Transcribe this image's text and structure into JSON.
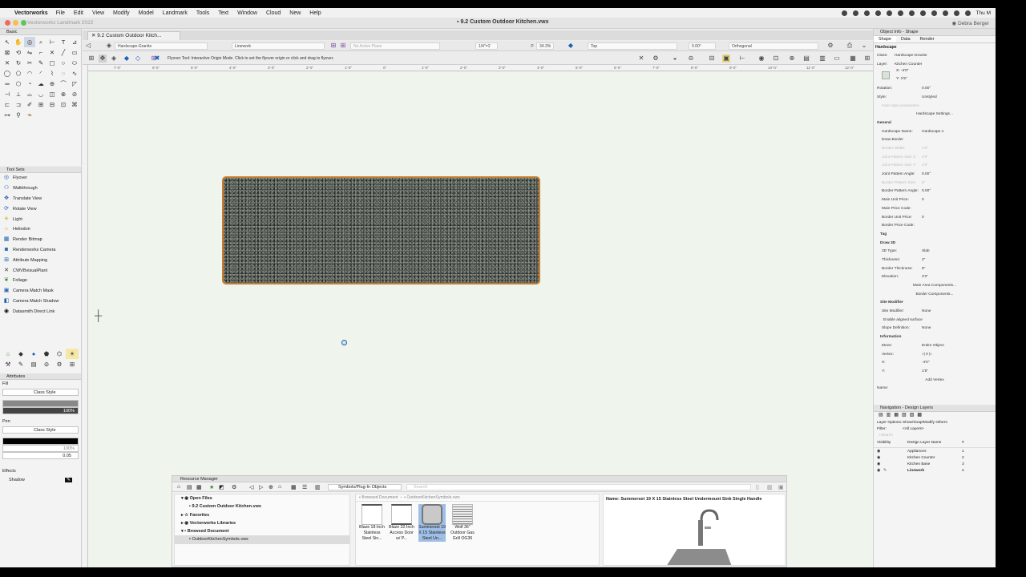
{
  "menubar": {
    "app": "Vectorworks",
    "items": [
      "File",
      "Edit",
      "View",
      "Modify",
      "Model",
      "Landmark",
      "Tools",
      "Text",
      "Window",
      "Cloud",
      "New",
      "Help"
    ],
    "clock": "Thu M"
  },
  "window": {
    "app_title": "Vectorworks Landmark 2022",
    "doc_title": "9.2 Custom Outdoor Kitchen.vwx",
    "user": "Debra Berger",
    "doc_tab": "9.2 Custom Outdoor Kitch..."
  },
  "viewbar": {
    "class_value": "Hardscape-Granite",
    "layer_value": "Linework",
    "active_plane": "No Active Plane",
    "scale": "1/4\"=1'",
    "zoom": "34.3%",
    "view": "Top",
    "rotation": "0.00°",
    "projection": "Orthogonal"
  },
  "modebar": {
    "help_text": "Flyover Tool: Interactive Origin Mode. Click to set the flyover origin or click and drag to flyover."
  },
  "rulers": {
    "top_ticks": [
      "7'-0\"",
      "6'-0\"",
      "5'-0\"",
      "4'-0\"",
      "3'-0\"",
      "2'-0\"",
      "1'-0\"",
      "0\"",
      "1'-0\"",
      "2'-0\"",
      "3'-0\"",
      "4'-0\"",
      "5'-0\"",
      "6'-0\"",
      "7'-0\"",
      "8'-0\"",
      "9'-0\"",
      "10'-0\"",
      "11'-0\"",
      "12'-0\""
    ]
  },
  "basic_palette": {
    "title": "Basic"
  },
  "tool_sets": {
    "title": "Tool Sets",
    "items": [
      "Flyover",
      "Walkthrough",
      "Translate View",
      "Rotate View",
      "Light",
      "Heliodon",
      "Render Bitmap",
      "Renderworks Camera",
      "Attribute Mapping",
      "CWVBvisualPlant",
      "Foliage",
      "Camera Match Mask",
      "Camera Match Shadow",
      "Datasmith Direct Link"
    ]
  },
  "attributes": {
    "title": "Attributes",
    "fill_label": "Fill",
    "fill_style": "Class Style",
    "fill_opacity": "100%",
    "pen_label": "Pen",
    "pen_style": "Class Style",
    "pen_opacity": "100%",
    "pen_thickness": "0.05",
    "effects_label": "Effects",
    "shadow_label": "Shadow"
  },
  "resource_manager": {
    "title": "Resource Manager",
    "library_dropdown": "Symbols/Plug-In Objects",
    "search_placeholder": "Search",
    "tree": [
      "Open Files",
      "9.2 Custom Outdoor Kitchen.vwx",
      "Favorites",
      "Vectorworks Libraries",
      "Browsed Document",
      "OutdoorKitchenSymbols.vwx"
    ],
    "crumb_1": "Browsed Document",
    "crumb_2": "OutdoorKitchenSymbols.vwx",
    "items": [
      "Blaze 18-Inch Stainless Steel Sin...",
      "Blaze 32-Inch Access Door w/ P...",
      "Summerset 19 X 15 Stainless Steel Un...",
      "Wolf 36\" Outdoor Gas Grill OG36"
    ],
    "preview_name": "Name: Summerset 19 X 15 Stainless Steel Undermount Sink Single Handle"
  },
  "object_info": {
    "title": "Object Info - Shape",
    "tabs": [
      "Shape",
      "Data",
      "Render"
    ],
    "object_type": "Hardscape",
    "class_label": "Class:",
    "class_value": "Hardscape-Granite",
    "layer_label": "Layer:",
    "layer_value": "Kitchen Counter",
    "x_label": "X:",
    "x_value": "-4'0\"",
    "y_label": "Y:",
    "y_value": "1'5\"",
    "rotation_label": "Rotation:",
    "rotation_value": "0.00°",
    "style_label": "Style:",
    "style_value": "Unstyled",
    "hide_style": "Hide style parameters",
    "settings_button": "Hardscape Settings...",
    "general": "General",
    "rows": [
      {
        "label": "Hardscape Name:",
        "value": "Hardscape-1",
        "dis": false
      },
      {
        "label": "Draw Border",
        "value": "",
        "dis": false
      },
      {
        "label": "Border Width:",
        "value": "1'0\"",
        "dis": true
      },
      {
        "label": "Joint Pattern Size X:",
        "value": "4'0\"",
        "dis": true
      },
      {
        "label": "Joint Pattern Size Y:",
        "value": "4'0\"",
        "dis": true
      },
      {
        "label": "Joint Pattern Angle:",
        "value": "0.00°",
        "dis": false
      },
      {
        "label": "Border Pattern Size:",
        "value": "6\"",
        "dis": true
      },
      {
        "label": "Border Pattern Angle:",
        "value": "0.00°",
        "dis": false
      },
      {
        "label": "Main Unit Price:",
        "value": "0",
        "dis": false
      },
      {
        "label": "Main Price Code:",
        "value": "",
        "dis": false
      },
      {
        "label": "Border Unit Price:",
        "value": "0",
        "dis": false
      },
      {
        "label": "Border Price Code:",
        "value": "",
        "dis": false
      }
    ],
    "tag": "Tag",
    "draw3d": "Draw 3D",
    "rows3d": [
      {
        "label": "3D Type:",
        "value": "Slab"
      },
      {
        "label": "Thickness:",
        "value": "2\""
      },
      {
        "label": "Border Thickness:",
        "value": "8\""
      },
      {
        "label": "Elevation:",
        "value": "3'2\""
      }
    ],
    "main_area_button": "Main Area Components...",
    "border_button": "Border Components...",
    "site_modifier": "Site Modifier",
    "site_mod_label": "Site Modifier:",
    "site_mod_value": "None",
    "enable_aligned": "Enable aligned surface",
    "slope_label": "Slope Definition:",
    "slope_value": "None",
    "information": "Information",
    "move_label": "Move:",
    "move_value": "Entire Object",
    "vertex_label": "Vertex:",
    "vertex_value": "0",
    "vx_label": "X:",
    "vx_value": "-4'0\"",
    "vy_label": "Y:",
    "vy_value": "1'5\"",
    "add_vertex": "Add Vertex",
    "name_label": "Name:"
  },
  "navigation": {
    "title": "Navigation - Design Layers",
    "layer_options_label": "Layer Options:",
    "layer_options_value": "Show/Snap/Modify Others",
    "filter_label": "Filter:",
    "filter_value": "<All Layers>",
    "search_placeholder": "Search",
    "col_visibility": "Visibility",
    "col_name": "Design Layer Name",
    "col_num": "#",
    "layers": [
      {
        "name": "Appliances",
        "num": "1",
        "active": false
      },
      {
        "name": "Kitchen Counter",
        "num": "2",
        "active": false
      },
      {
        "name": "Kitchen Base",
        "num": "3",
        "active": false
      },
      {
        "name": "Linework",
        "num": "4",
        "active": true
      }
    ]
  },
  "colors": {
    "canvas": "#eff4ec",
    "selection": "#c77d2e",
    "accent": "#1a5fb4"
  }
}
